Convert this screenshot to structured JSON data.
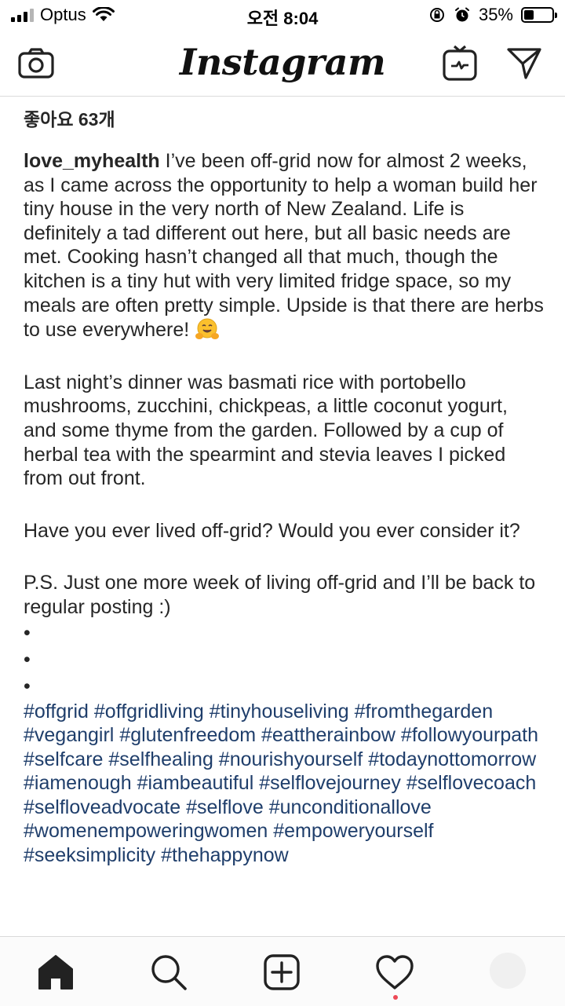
{
  "status_bar": {
    "carrier": "Optus",
    "time": "오전 8:04",
    "battery_percent": "35%",
    "battery_level": 0.35,
    "icons": [
      "signal-icon",
      "wifi-icon",
      "orientation-lock-icon",
      "alarm-icon",
      "battery-icon"
    ]
  },
  "header": {
    "brand": "Instagram",
    "left_icon": "camera-icon",
    "right_icons": [
      "igtv-icon",
      "direct-message-icon"
    ]
  },
  "post": {
    "likes": "좋아요 63개",
    "username": "love_myhealth",
    "caption_intro": " I’ve been off-grid now for almost 2 weeks, as I came across the opportunity to help a woman build her tiny house in the very north of New Zealand. Life is definitely a tad different out here, but all basic needs are met. Cooking hasn’t changed all that much, though the kitchen is a tiny hut with very limited fridge space, so my meals are often pretty simple. Upside is that there are herbs to use everywhere! ",
    "emoji": "hugging-face-emoji",
    "paragraph_2": "Last night’s dinner was basmati rice with portobello mushrooms, zucchini, chickpeas, a little coconut yogurt, and some thyme from the garden. Followed by a cup of herbal tea with the spearmint and stevia leaves I picked from out front.",
    "paragraph_3": "Have you ever lived off-grid? Would you ever consider it?",
    "paragraph_4": "P.S. Just one more week of living off-grid and I’ll be back to regular posting :)",
    "bullets": [
      "•",
      "•",
      "•"
    ],
    "hashtags": [
      "#offgrid",
      "#offgridliving",
      "#tinyhouseliving",
      "#fromthegarden",
      "#vegangirl",
      "#glutenfreedom",
      "#eattherainbow",
      "#followyourpath",
      "#selfcare",
      "#selfhealing",
      "#nourishyourself",
      "#todaynottomorrow",
      "#iamenough",
      "#iambeautiful",
      "#selflovejourney",
      "#selflovecoach",
      "#selfloveadvocate",
      "#selflove",
      "#unconditionallove",
      "#womenempoweringwomen",
      "#empoweryourself",
      "#seeksimplicity",
      "#thehappynow"
    ]
  },
  "tab_bar": {
    "tabs": [
      "home-icon",
      "search-icon",
      "new-post-icon",
      "activity-heart-icon",
      "profile-avatar"
    ],
    "activity_has_notification": true
  },
  "colors": {
    "text": "#262626",
    "hashtag": "#1f3e6b",
    "divider": "#dbdbdb",
    "notification": "#ed4956"
  }
}
